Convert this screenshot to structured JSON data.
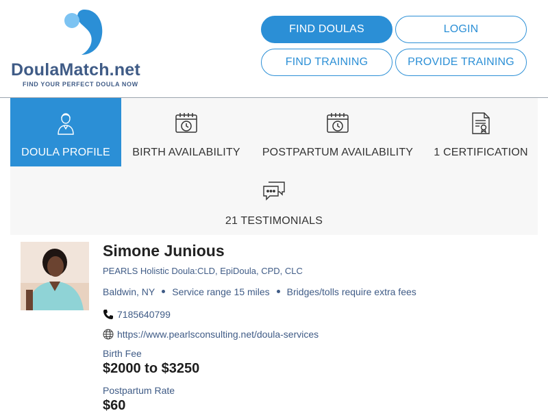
{
  "brand": {
    "name_part1": "Doula",
    "name_part2": "Match.net",
    "tagline": "FIND YOUR PERFECT DOULA NOW",
    "colors": {
      "accent": "#2b8fd6",
      "text": "#3f5b86"
    }
  },
  "nav": {
    "find_doulas": "FIND DOULAS",
    "login": "LOGIN",
    "find_training": "FIND TRAINING",
    "provide_training": "PROVIDE TRAINING"
  },
  "tabs": [
    {
      "label": "DOULA PROFILE",
      "icon": "doula-person-icon",
      "active": true
    },
    {
      "label": "BIRTH AVAILABILITY",
      "icon": "calendar-clock-icon",
      "active": false
    },
    {
      "label": "POSTPARTUM AVAILABILITY",
      "icon": "calendar-clock-icon",
      "active": false
    },
    {
      "label": "1 CERTIFICATION",
      "icon": "certificate-icon",
      "active": false
    },
    {
      "label": "21 TESTIMONIALS",
      "icon": "chat-bubbles-icon",
      "active": false
    }
  ],
  "profile": {
    "name": "Simone Junious",
    "credentials": "PEARLS Holistic Doula:CLD, EpiDoula, CPD, CLC",
    "location": "Baldwin, NY",
    "service_range": "Service range 15 miles",
    "tolls_note": "Bridges/tolls require extra fees",
    "phone": "7185640799",
    "website": "https://www.pearlsconsulting.net/doula-services",
    "birth_fee_label": "Birth Fee",
    "birth_fee": "$2000 to $3250",
    "postpartum_rate_label": "Postpartum Rate",
    "postpartum_rate": "$60"
  }
}
